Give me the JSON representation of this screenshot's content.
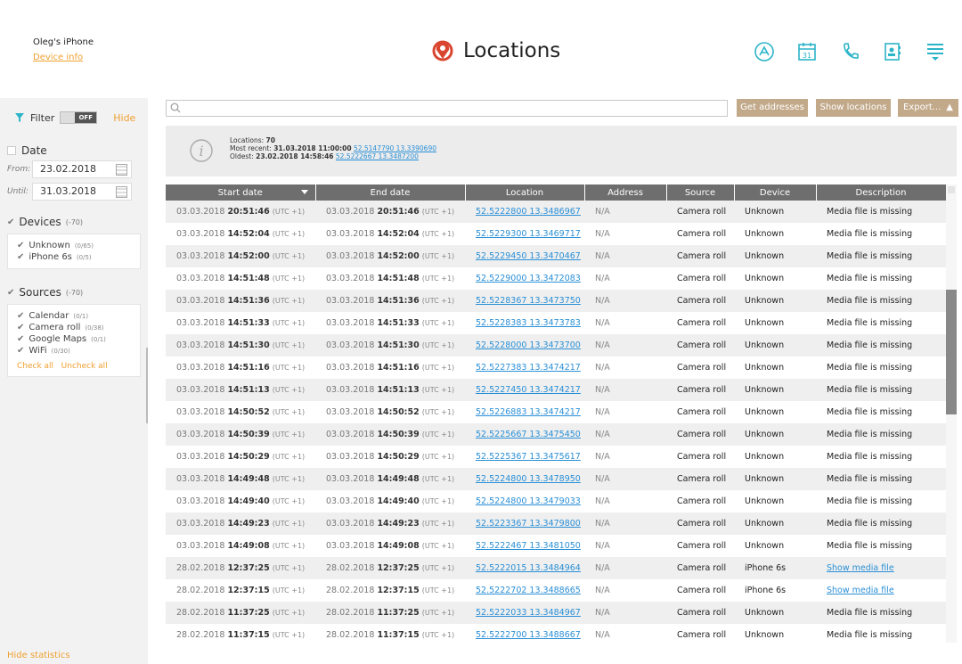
{
  "header": {
    "device_name": "Oleg's iPhone",
    "device_info": "Device info",
    "title": "Locations"
  },
  "sidebar": {
    "filter_label": "Filter",
    "toggle_label": "OFF",
    "hide_label": "Hide",
    "date_label": "Date",
    "from_label": "From:",
    "from_value": "23.02.2018",
    "until_label": "Until:",
    "until_value": "31.03.2018",
    "devices_label": "Devices",
    "devices_count": "(-70)",
    "devices": [
      {
        "label": "Unknown",
        "count": "(0/65)"
      },
      {
        "label": "iPhone 6s",
        "count": "(0/5)"
      }
    ],
    "sources_label": "Sources",
    "sources_count": "(-70)",
    "sources": [
      {
        "label": "Calendar",
        "count": "(0/1)"
      },
      {
        "label": "Camera roll",
        "count": "(0/38)"
      },
      {
        "label": "Google Maps",
        "count": "(0/1)"
      },
      {
        "label": "WiFi",
        "count": "(0/30)"
      }
    ],
    "check_all": "Check all",
    "uncheck_all": "Uncheck all",
    "hide_statistics": "Hide statistics"
  },
  "toolbar": {
    "search_placeholder": "",
    "get_addresses": "Get addresses",
    "show_locations": "Show locations",
    "export": "Export..."
  },
  "stats": {
    "locations_label": "Locations:",
    "locations_value": "70",
    "most_recent_label": "Most recent:",
    "most_recent_value": "31.03.2018 11:00:00",
    "most_recent_link": "52.5147790 13.3390690",
    "oldest_label": "Oldest:",
    "oldest_value": "23.02.2018 14:58:46",
    "oldest_link": "52.5222667 13.3487200"
  },
  "table": {
    "columns": [
      "Start date",
      "End date",
      "Location",
      "Address",
      "Source",
      "Device",
      "Description"
    ],
    "rows": [
      {
        "date": "03.03.2018",
        "time": "20:51:46",
        "tz": "(UTC +1)",
        "location": "52.5222800 13.3486967",
        "address": "N/A",
        "source": "Camera roll",
        "device": "Unknown",
        "description": "Media file is missing"
      },
      {
        "date": "03.03.2018",
        "time": "14:52:04",
        "tz": "(UTC +1)",
        "location": "52.5229300 13.3469717",
        "address": "N/A",
        "source": "Camera roll",
        "device": "Unknown",
        "description": "Media file is missing"
      },
      {
        "date": "03.03.2018",
        "time": "14:52:00",
        "tz": "(UTC +1)",
        "location": "52.5229450 13.3470467",
        "address": "N/A",
        "source": "Camera roll",
        "device": "Unknown",
        "description": "Media file is missing"
      },
      {
        "date": "03.03.2018",
        "time": "14:51:48",
        "tz": "(UTC +1)",
        "location": "52.5229000 13.3472083",
        "address": "N/A",
        "source": "Camera roll",
        "device": "Unknown",
        "description": "Media file is missing"
      },
      {
        "date": "03.03.2018",
        "time": "14:51:36",
        "tz": "(UTC +1)",
        "location": "52.5228367 13.3473750",
        "address": "N/A",
        "source": "Camera roll",
        "device": "Unknown",
        "description": "Media file is missing"
      },
      {
        "date": "03.03.2018",
        "time": "14:51:33",
        "tz": "(UTC +1)",
        "location": "52.5228383 13.3473783",
        "address": "N/A",
        "source": "Camera roll",
        "device": "Unknown",
        "description": "Media file is missing"
      },
      {
        "date": "03.03.2018",
        "time": "14:51:30",
        "tz": "(UTC +1)",
        "location": "52.5228000 13.3473700",
        "address": "N/A",
        "source": "Camera roll",
        "device": "Unknown",
        "description": "Media file is missing"
      },
      {
        "date": "03.03.2018",
        "time": "14:51:16",
        "tz": "(UTC +1)",
        "location": "52.5227383 13.3474217",
        "address": "N/A",
        "source": "Camera roll",
        "device": "Unknown",
        "description": "Media file is missing"
      },
      {
        "date": "03.03.2018",
        "time": "14:51:13",
        "tz": "(UTC +1)",
        "location": "52.5227450 13.3474217",
        "address": "N/A",
        "source": "Camera roll",
        "device": "Unknown",
        "description": "Media file is missing"
      },
      {
        "date": "03.03.2018",
        "time": "14:50:52",
        "tz": "(UTC +1)",
        "location": "52.5226883 13.3474217",
        "address": "N/A",
        "source": "Camera roll",
        "device": "Unknown",
        "description": "Media file is missing"
      },
      {
        "date": "03.03.2018",
        "time": "14:50:39",
        "tz": "(UTC +1)",
        "location": "52.5225667 13.3475450",
        "address": "N/A",
        "source": "Camera roll",
        "device": "Unknown",
        "description": "Media file is missing"
      },
      {
        "date": "03.03.2018",
        "time": "14:50:29",
        "tz": "(UTC +1)",
        "location": "52.5225367 13.3475617",
        "address": "N/A",
        "source": "Camera roll",
        "device": "Unknown",
        "description": "Media file is missing"
      },
      {
        "date": "03.03.2018",
        "time": "14:49:48",
        "tz": "(UTC +1)",
        "location": "52.5224800 13.3478950",
        "address": "N/A",
        "source": "Camera roll",
        "device": "Unknown",
        "description": "Media file is missing"
      },
      {
        "date": "03.03.2018",
        "time": "14:49:40",
        "tz": "(UTC +1)",
        "location": "52.5224800 13.3479033",
        "address": "N/A",
        "source": "Camera roll",
        "device": "Unknown",
        "description": "Media file is missing"
      },
      {
        "date": "03.03.2018",
        "time": "14:49:23",
        "tz": "(UTC +1)",
        "location": "52.5223367 13.3479800",
        "address": "N/A",
        "source": "Camera roll",
        "device": "Unknown",
        "description": "Media file is missing"
      },
      {
        "date": "03.03.2018",
        "time": "14:49:08",
        "tz": "(UTC +1)",
        "location": "52.5222467 13.3481050",
        "address": "N/A",
        "source": "Camera roll",
        "device": "Unknown",
        "description": "Media file is missing"
      },
      {
        "date": "28.02.2018",
        "time": "12:37:25",
        "tz": "(UTC +1)",
        "location": "52.5222015 13.3484964",
        "address": "N/A",
        "source": "Camera roll",
        "device": "iPhone 6s",
        "description": "Show media file",
        "media": true
      },
      {
        "date": "28.02.2018",
        "time": "12:37:15",
        "tz": "(UTC +1)",
        "location": "52.5222702 13.3488665",
        "address": "N/A",
        "source": "Camera roll",
        "device": "iPhone 6s",
        "description": "Show media file",
        "media": true
      },
      {
        "date": "28.02.2018",
        "time": "11:37:25",
        "tz": "(UTC +1)",
        "location": "52.5222033 13.3484967",
        "address": "N/A",
        "source": "Camera roll",
        "device": "Unknown",
        "description": "Media file is missing"
      },
      {
        "date": "28.02.2018",
        "time": "11:37:15",
        "tz": "(UTC +1)",
        "location": "52.5222700 13.3488667",
        "address": "N/A",
        "source": "Camera roll",
        "device": "Unknown",
        "description": "Media file is missing"
      }
    ]
  },
  "icons": {
    "title": "location-pin-icon",
    "top": [
      "app-store-icon",
      "calendar-icon",
      "phone-icon",
      "contacts-icon",
      "menu-icon"
    ]
  },
  "colors": {
    "accent": "#f0a030",
    "title_icon": "#d9452f",
    "top_icons": "#2cb4c8",
    "button": "#c2a98a",
    "link": "#2a8fd6",
    "table_header": "#6e6e6e"
  }
}
